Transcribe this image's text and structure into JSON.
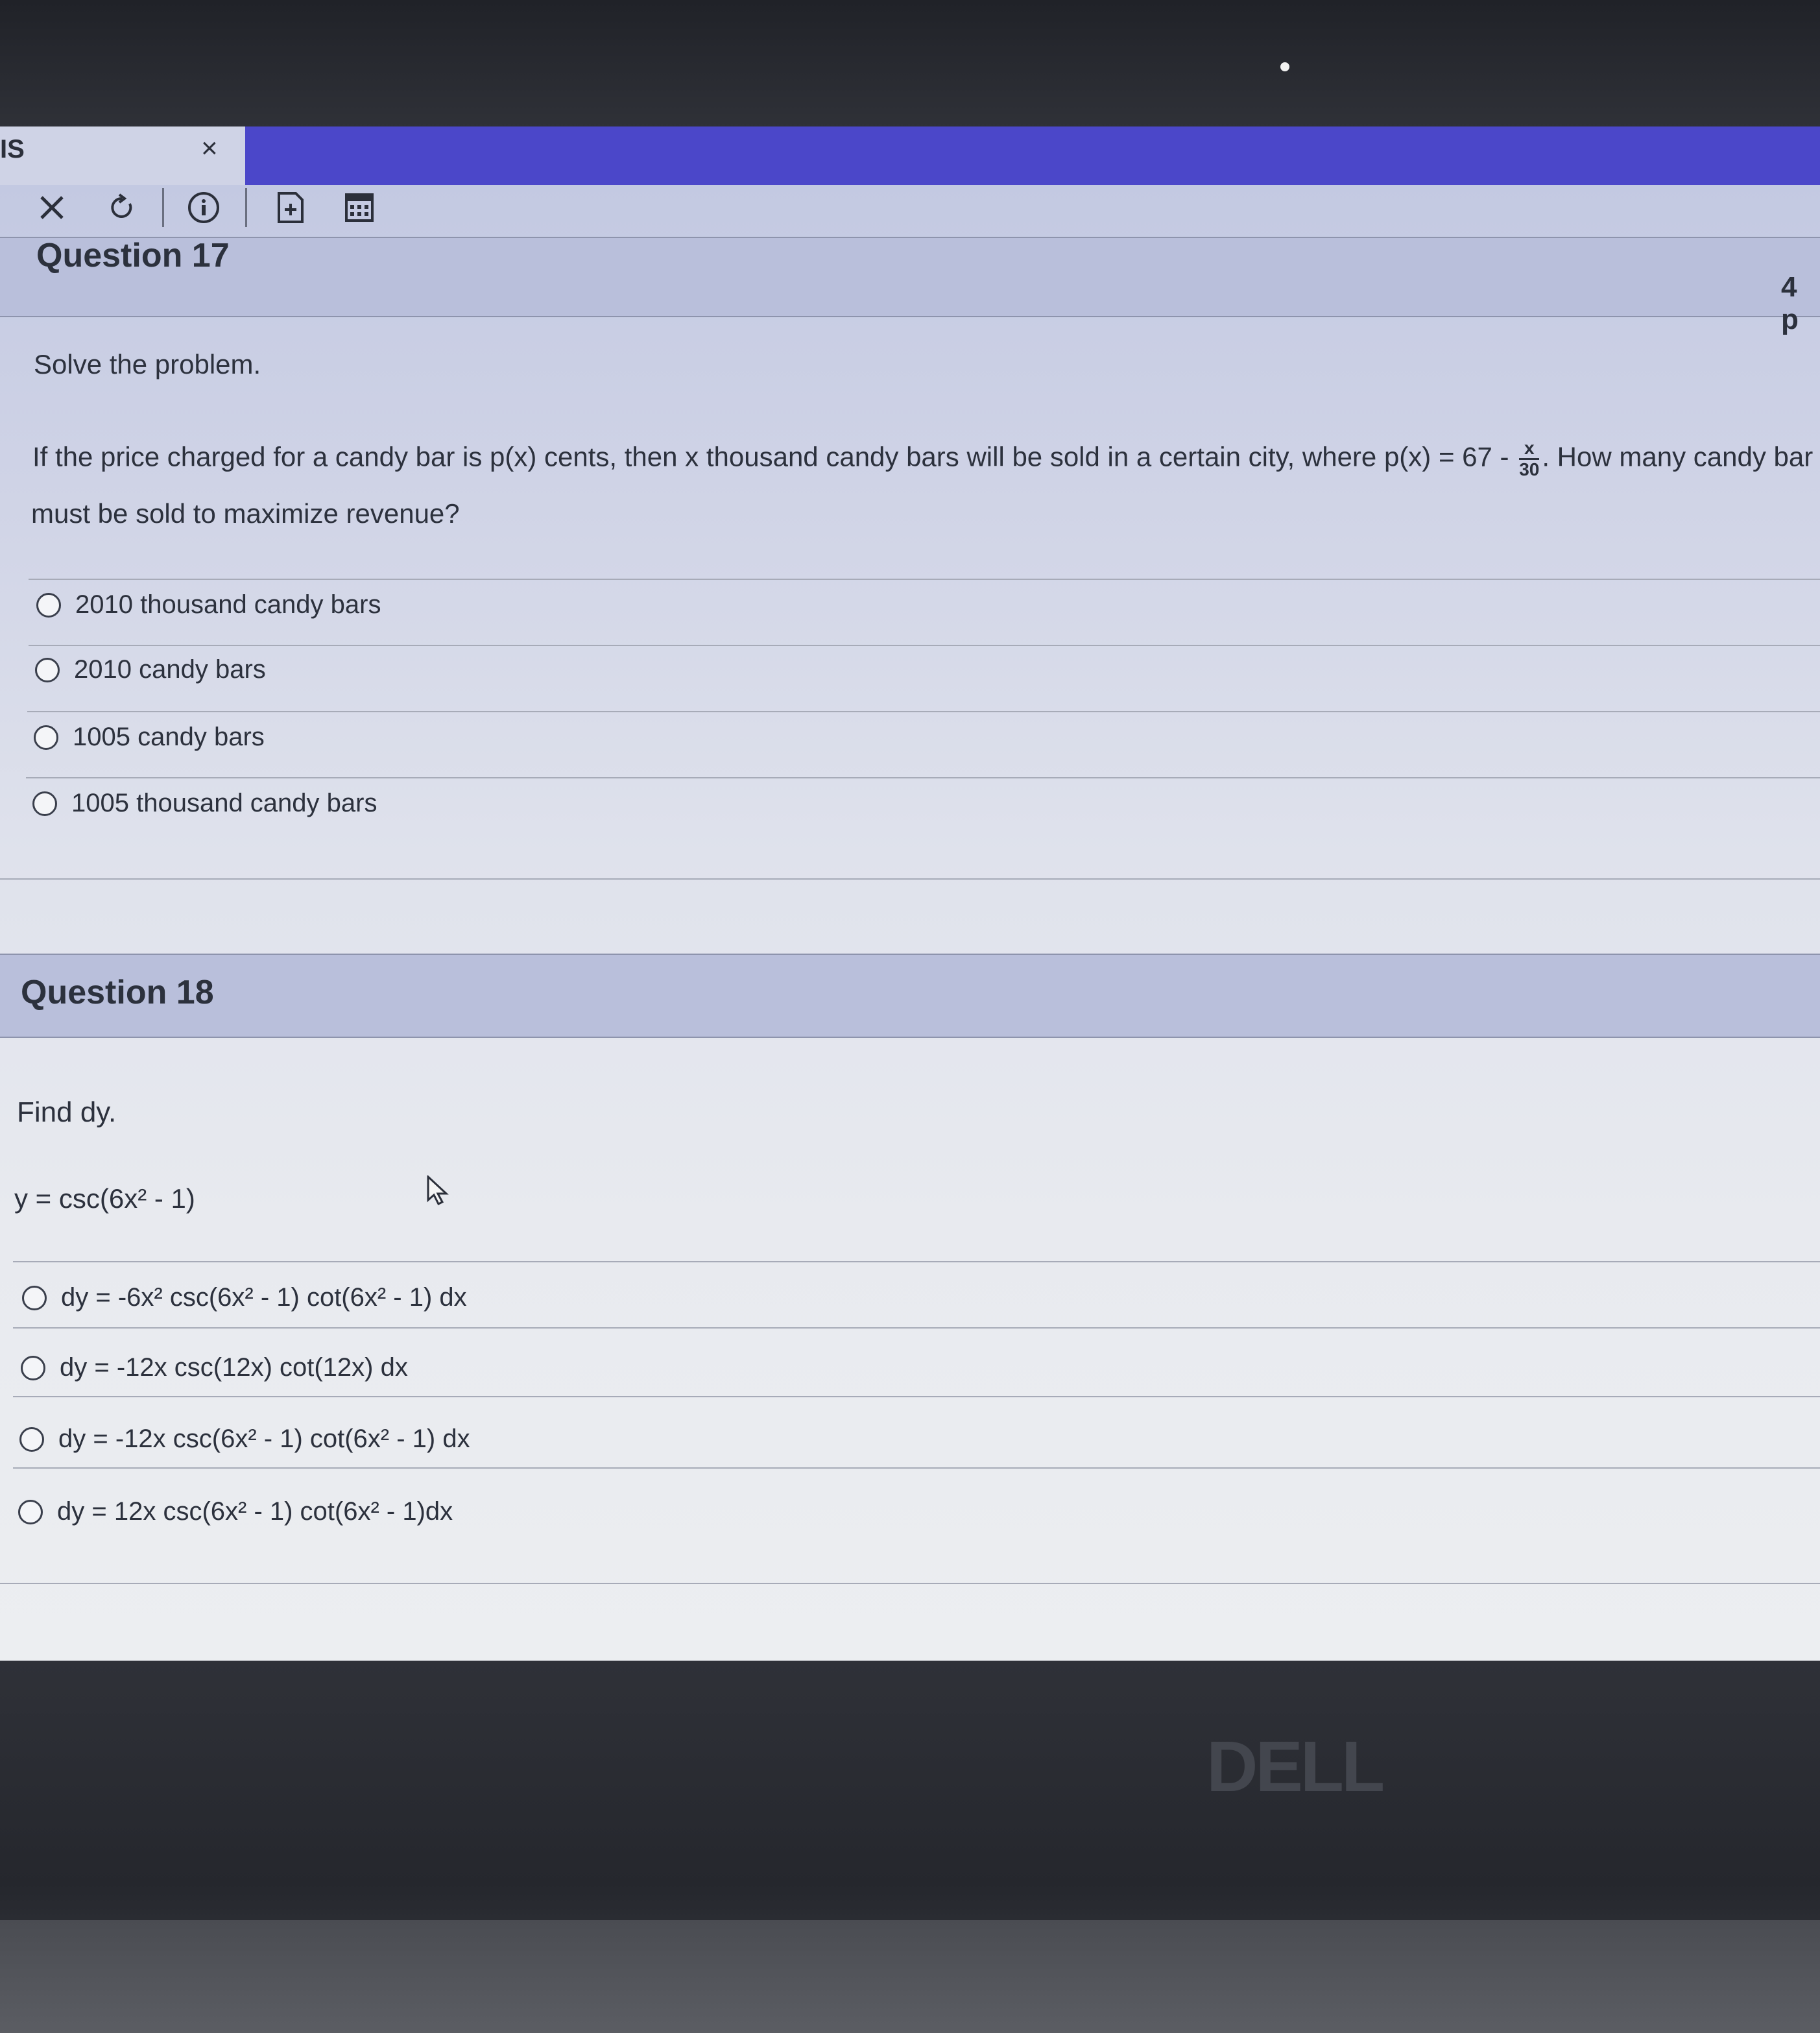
{
  "browser": {
    "tab_title": "IS",
    "tab_close": "×"
  },
  "toolbar": {
    "close_icon": "close-icon",
    "refresh_icon": "refresh-icon",
    "info_icon": "info-icon",
    "add_page_icon": "add-page-icon",
    "calculator_icon": "calculator-icon"
  },
  "q17": {
    "title": "Question 17",
    "points": "4 p",
    "instruction": "Solve the problem.",
    "text_part1": "If the price charged for a candy bar is p(x) cents, then x thousand candy bars will be sold in a certain city, where p(x) = 67 - ",
    "frac_num": "x",
    "frac_den": "30",
    "text_part2": ". How many candy bar",
    "text_line2": "must be sold to maximize revenue?",
    "options": [
      "2010 thousand candy bars",
      "2010 candy bars",
      "1005 candy bars",
      "1005 thousand candy bars"
    ]
  },
  "q18": {
    "title": "Question 18",
    "instruction": "Find dy.",
    "equation": "y = csc(6x² - 1)",
    "options": [
      "dy = -6x² csc(6x² - 1) cot(6x² - 1) dx",
      "dy = -12x csc(12x) cot(12x) dx",
      "dy = -12x csc(6x² - 1) cot(6x² - 1) dx",
      "dy = 12x csc(6x² - 1) cot(6x² - 1)dx"
    ]
  },
  "brand": "DELL",
  "colors": {
    "tab_accent": "#4b47c9",
    "header_bg": "#b9bfdb"
  }
}
